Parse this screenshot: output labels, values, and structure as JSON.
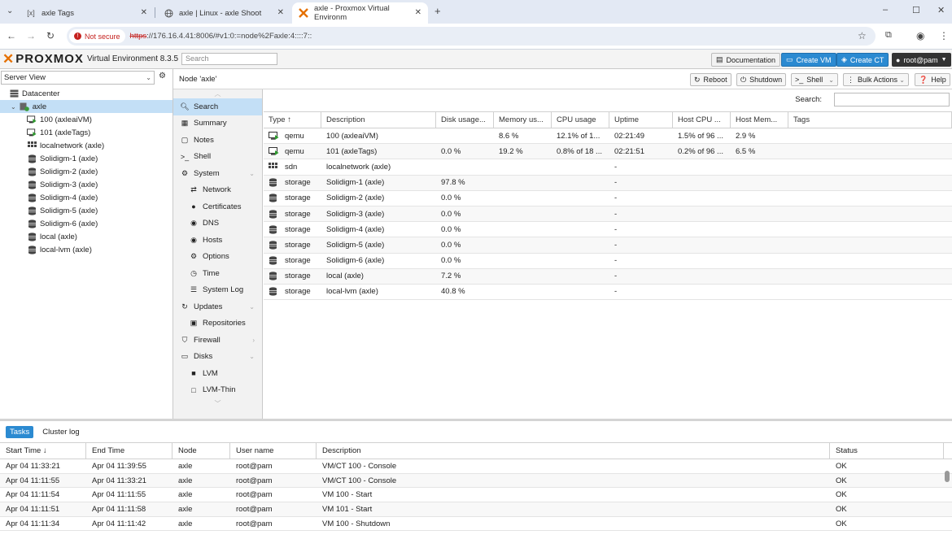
{
  "browser": {
    "tabs": [
      {
        "icon": "tag-icon",
        "title": "axle Tags"
      },
      {
        "icon": "globe-icon",
        "title": "axle | Linux - axle Shoot"
      },
      {
        "icon": "proxmox-icon",
        "title": "axle - Proxmox Virtual Environm"
      }
    ],
    "new_tab": "+",
    "minimize": "–",
    "maximize": "☐",
    "close": "✕",
    "url_warning": "Not secure",
    "url_scheme": "https",
    "url_rest": "://176.16.4.41:8006/#v1:0:=node%2Faxle:4::::7::"
  },
  "pve": {
    "logo": "PROXMOX",
    "version": "Virtual Environment 8.3.5",
    "search_placeholder": "Search",
    "documentation": "Documentation",
    "create_vm": "Create VM",
    "create_ct": "Create CT",
    "user": "root@pam"
  },
  "left": {
    "view": "Server View",
    "tree": [
      {
        "label": "Datacenter",
        "icon": "datacenter-icon",
        "indent": 1
      },
      {
        "label": "axle",
        "icon": "node-icon",
        "indent": 2,
        "selected": true
      },
      {
        "label": "100 (axleaiVM)",
        "icon": "vm-running-icon",
        "indent": 3
      },
      {
        "label": "101 (axleTags)",
        "icon": "vm-running-icon",
        "indent": 3
      },
      {
        "label": "localnetwork (axle)",
        "icon": "sdn-icon",
        "indent": 3
      },
      {
        "label": "Solidigm-1 (axle)",
        "icon": "storage-icon",
        "indent": 3
      },
      {
        "label": "Solidigm-2 (axle)",
        "icon": "storage-icon",
        "indent": 3
      },
      {
        "label": "Solidigm-3 (axle)",
        "icon": "storage-icon",
        "indent": 3
      },
      {
        "label": "Solidigm-4 (axle)",
        "icon": "storage-icon",
        "indent": 3
      },
      {
        "label": "Solidigm-5 (axle)",
        "icon": "storage-icon",
        "indent": 3
      },
      {
        "label": "Solidigm-6 (axle)",
        "icon": "storage-icon",
        "indent": 3
      },
      {
        "label": "local (axle)",
        "icon": "storage-icon",
        "indent": 3
      },
      {
        "label": "local-lvm (axle)",
        "icon": "storage-icon",
        "indent": 3
      }
    ]
  },
  "node": {
    "title": "Node 'axle'",
    "reboot": "Reboot",
    "shutdown": "Shutdown",
    "shell": "Shell",
    "bulk": "Bulk Actions",
    "help": "Help",
    "search_label": "Search:"
  },
  "menu": [
    {
      "label": "Search",
      "icon": "search-icon",
      "sub": false,
      "selected": true
    },
    {
      "label": "Summary",
      "icon": "summary-icon",
      "sub": false
    },
    {
      "label": "Notes",
      "icon": "notes-icon",
      "sub": false
    },
    {
      "label": "Shell",
      "icon": "shell-icon",
      "sub": false
    },
    {
      "label": "System",
      "icon": "system-icon",
      "sub": false,
      "arrow": true
    },
    {
      "label": "Network",
      "icon": "network-icon",
      "sub": true
    },
    {
      "label": "Certificates",
      "icon": "certificate-icon",
      "sub": true
    },
    {
      "label": "DNS",
      "icon": "dns-icon",
      "sub": true
    },
    {
      "label": "Hosts",
      "icon": "hosts-icon",
      "sub": true
    },
    {
      "label": "Options",
      "icon": "options-icon",
      "sub": true
    },
    {
      "label": "Time",
      "icon": "time-icon",
      "sub": true
    },
    {
      "label": "System Log",
      "icon": "syslog-icon",
      "sub": true
    },
    {
      "label": "Updates",
      "icon": "updates-icon",
      "sub": false,
      "arrow": true
    },
    {
      "label": "Repositories",
      "icon": "repositories-icon",
      "sub": true
    },
    {
      "label": "Firewall",
      "icon": "firewall-icon",
      "sub": false,
      "arrow": true
    },
    {
      "label": "Disks",
      "icon": "disks-icon",
      "sub": false,
      "arrow": true
    },
    {
      "label": "LVM",
      "icon": "lvm-icon",
      "sub": true
    },
    {
      "label": "LVM-Thin",
      "icon": "lvm-thin-icon",
      "sub": true
    }
  ],
  "resources": {
    "columns": [
      "Type ↑",
      "Description",
      "Disk usage...",
      "Memory us...",
      "CPU usage",
      "Uptime",
      "Host CPU ...",
      "Host Mem...",
      "Tags"
    ],
    "rows": [
      {
        "type": "qemu",
        "icon": "vm-running-icon",
        "desc": "100 (axleaiVM)",
        "disk": "",
        "mem": "8.6 %",
        "cpu": "12.1% of 1...",
        "uptime": "02:21:49",
        "hcpu": "1.5% of 96 ...",
        "hmem": "2.9 %",
        "tags": ""
      },
      {
        "type": "qemu",
        "icon": "vm-running-icon",
        "desc": "101 (axleTags)",
        "disk": "0.0 %",
        "mem": "19.2 %",
        "cpu": "0.8% of 18 ...",
        "uptime": "02:21:51",
        "hcpu": "0.2% of 96 ...",
        "hmem": "6.5 %",
        "tags": ""
      },
      {
        "type": "sdn",
        "icon": "sdn-icon",
        "desc": "localnetwork (axle)",
        "disk": "",
        "mem": "",
        "cpu": "",
        "uptime": "-",
        "hcpu": "",
        "hmem": "",
        "tags": ""
      },
      {
        "type": "storage",
        "icon": "storage-icon",
        "desc": "Solidigm-1 (axle)",
        "disk": "97.8 %",
        "mem": "",
        "cpu": "",
        "uptime": "-",
        "hcpu": "",
        "hmem": "",
        "tags": ""
      },
      {
        "type": "storage",
        "icon": "storage-icon",
        "desc": "Solidigm-2 (axle)",
        "disk": "0.0 %",
        "mem": "",
        "cpu": "",
        "uptime": "-",
        "hcpu": "",
        "hmem": "",
        "tags": ""
      },
      {
        "type": "storage",
        "icon": "storage-icon",
        "desc": "Solidigm-3 (axle)",
        "disk": "0.0 %",
        "mem": "",
        "cpu": "",
        "uptime": "-",
        "hcpu": "",
        "hmem": "",
        "tags": ""
      },
      {
        "type": "storage",
        "icon": "storage-icon",
        "desc": "Solidigm-4 (axle)",
        "disk": "0.0 %",
        "mem": "",
        "cpu": "",
        "uptime": "-",
        "hcpu": "",
        "hmem": "",
        "tags": ""
      },
      {
        "type": "storage",
        "icon": "storage-icon",
        "desc": "Solidigm-5 (axle)",
        "disk": "0.0 %",
        "mem": "",
        "cpu": "",
        "uptime": "-",
        "hcpu": "",
        "hmem": "",
        "tags": ""
      },
      {
        "type": "storage",
        "icon": "storage-icon",
        "desc": "Solidigm-6 (axle)",
        "disk": "0.0 %",
        "mem": "",
        "cpu": "",
        "uptime": "-",
        "hcpu": "",
        "hmem": "",
        "tags": ""
      },
      {
        "type": "storage",
        "icon": "storage-icon",
        "desc": "local (axle)",
        "disk": "7.2 %",
        "mem": "",
        "cpu": "",
        "uptime": "-",
        "hcpu": "",
        "hmem": "",
        "tags": ""
      },
      {
        "type": "storage",
        "icon": "storage-icon",
        "desc": "local-lvm (axle)",
        "disk": "40.8 %",
        "mem": "",
        "cpu": "",
        "uptime": "-",
        "hcpu": "",
        "hmem": "",
        "tags": ""
      }
    ]
  },
  "tasks": {
    "tabs": [
      "Tasks",
      "Cluster log"
    ],
    "columns": [
      "Start Time ↓",
      "End Time",
      "Node",
      "User name",
      "Description",
      "Status"
    ],
    "rows": [
      [
        "Apr 04 11:33:21",
        "Apr 04 11:39:55",
        "axle",
        "root@pam",
        "VM/CT 100 - Console",
        "OK"
      ],
      [
        "Apr 04 11:11:55",
        "Apr 04 11:33:21",
        "axle",
        "root@pam",
        "VM/CT 100 - Console",
        "OK"
      ],
      [
        "Apr 04 11:11:54",
        "Apr 04 11:11:55",
        "axle",
        "root@pam",
        "VM 100 - Start",
        "OK"
      ],
      [
        "Apr 04 11:11:51",
        "Apr 04 11:11:58",
        "axle",
        "root@pam",
        "VM 101 - Start",
        "OK"
      ],
      [
        "Apr 04 11:11:34",
        "Apr 04 11:11:42",
        "axle",
        "root@pam",
        "VM 100 - Shutdown",
        "OK"
      ]
    ]
  },
  "colors": {
    "accent": "#2b8ad1",
    "selection": "#c3dff6",
    "logo_orange": "#e57000",
    "insecure_red": "#c5221f"
  }
}
